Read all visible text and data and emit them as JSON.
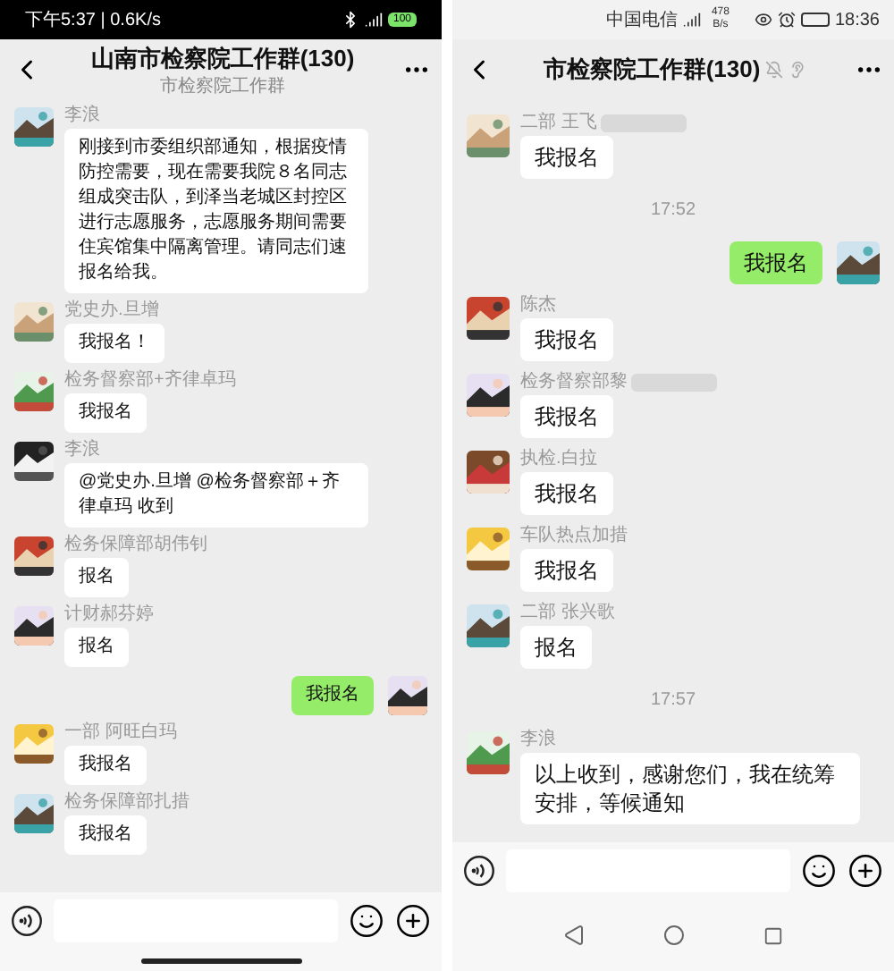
{
  "panels": [
    {
      "status_bar": {
        "left": "下午5:37 | 0.6K/s",
        "battery": "100"
      },
      "header": {
        "title": "山南市检察院工作群(130)",
        "subtitle": "市检察院工作群"
      },
      "messages": [
        {
          "kind": "text",
          "sender": "李浪",
          "text": "刚接到市委组织部通知，根据疫情防控需要，现在需要我院８名同志组成突击队，到泽当老城区封控区进行志愿服务，志愿服务期间需要住宾馆集中隔离管理。请同志们速报名给我。",
          "outgoing": false
        },
        {
          "kind": "text",
          "sender": "党史办.旦增",
          "text": "我报名！",
          "outgoing": false
        },
        {
          "kind": "text",
          "sender": "检务督察部+齐律卓玛",
          "text": "我报名",
          "outgoing": false
        },
        {
          "kind": "text",
          "sender": "李浪",
          "text": "@党史办.旦增 @检务督察部＋齐律卓玛  收到",
          "outgoing": false
        },
        {
          "kind": "text",
          "sender": "检务保障部胡伟钊",
          "text": "报名",
          "outgoing": false
        },
        {
          "kind": "text",
          "sender": "计财郝芬婷",
          "text": "报名",
          "outgoing": false
        },
        {
          "kind": "text",
          "text": "我报名",
          "outgoing": true
        },
        {
          "kind": "text",
          "sender": "一部 阿旺白玛",
          "text": "我报名",
          "outgoing": false
        },
        {
          "kind": "text",
          "sender": "检务保障部扎措",
          "text": "我报名",
          "outgoing": false
        }
      ],
      "nav_bar": {
        "kind": "gesture"
      }
    },
    {
      "status_bar": {
        "carrier": "中国电信",
        "speed": "478 B/s",
        "time": "18:36"
      },
      "header": {
        "title": "市检察院工作群(130)",
        "muted": true
      },
      "messages": [
        {
          "kind": "text",
          "sender": "二部 王飞",
          "text": "我报名",
          "outgoing": false,
          "redacted": true
        },
        {
          "kind": "time",
          "text": "17:52"
        },
        {
          "kind": "text",
          "text": "我报名",
          "outgoing": true
        },
        {
          "kind": "text",
          "sender": "陈杰",
          "text": "我报名",
          "outgoing": false
        },
        {
          "kind": "text",
          "sender": "检务督察部黎",
          "text": "我报名",
          "outgoing": false,
          "redacted": true
        },
        {
          "kind": "text",
          "sender": "执检.白拉",
          "text": "我报名",
          "outgoing": false
        },
        {
          "kind": "text",
          "sender": "车队热点加措",
          "text": "我报名",
          "outgoing": false
        },
        {
          "kind": "text",
          "sender": "二部 张兴歌",
          "text": "报名",
          "outgoing": false
        },
        {
          "kind": "time",
          "text": "17:57"
        },
        {
          "kind": "text",
          "sender": "李浪",
          "text": "以上收到，感谢您们，我在统筹安排，等候通知",
          "outgoing": false
        }
      ],
      "nav_bar": {
        "kind": "buttons"
      }
    }
  ]
}
